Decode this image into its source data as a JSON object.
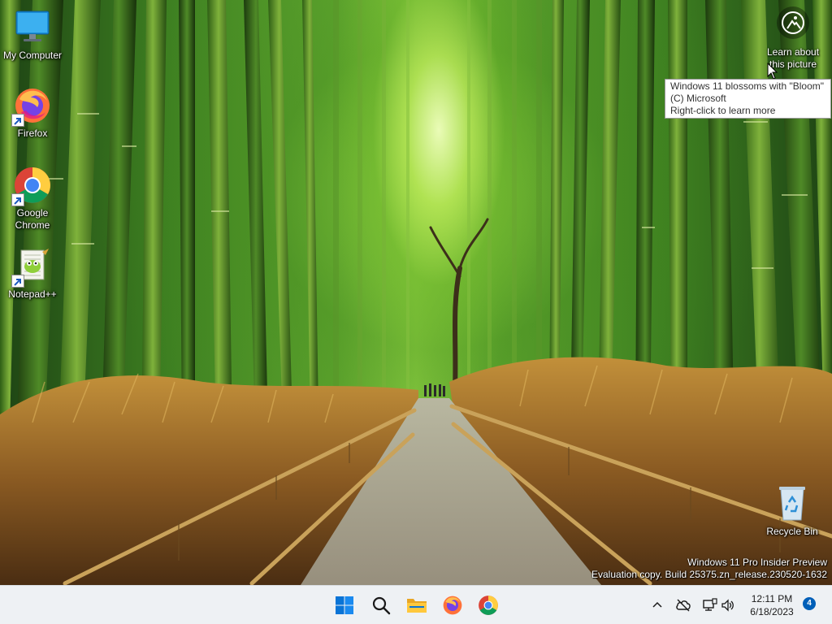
{
  "desktop": {
    "icons": [
      {
        "label": "My Computer",
        "icon": "monitor-icon"
      },
      {
        "label": "Firefox",
        "icon": "firefox-icon"
      },
      {
        "label": "Google\nChrome",
        "icon": "chrome-icon"
      },
      {
        "label": "Notepad++",
        "icon": "notepadpp-icon"
      },
      {
        "label": "Recycle Bin",
        "icon": "recycle-bin-icon"
      }
    ],
    "learn_about": {
      "label": "Learn about\nthis picture",
      "icon": "learn-picture-icon"
    },
    "tooltip": {
      "line1": "Windows 11 blossoms with \"Bloom\"",
      "line2": "(C) Microsoft",
      "line3": "Right-click to learn more"
    },
    "watermark": {
      "line1": "Windows 11 Pro Insider Preview",
      "line2": "Evaluation copy. Build 25375.zn_release.230520-1632"
    }
  },
  "taskbar": {
    "apps": [
      {
        "name": "Start",
        "icon": "windows-start-icon"
      },
      {
        "name": "Search",
        "icon": "search-icon"
      },
      {
        "name": "File Explorer",
        "icon": "folder-icon"
      },
      {
        "name": "Firefox",
        "icon": "firefox-icon"
      },
      {
        "name": "Google Chrome",
        "icon": "chrome-icon"
      }
    ],
    "tray": {
      "time": "12:11 PM",
      "date": "6/18/2023",
      "notification_count": "4"
    }
  },
  "colors": {
    "taskbar_bg": "#eef1f4",
    "accent": "#005fb8",
    "start_blue": "#0078d4"
  }
}
